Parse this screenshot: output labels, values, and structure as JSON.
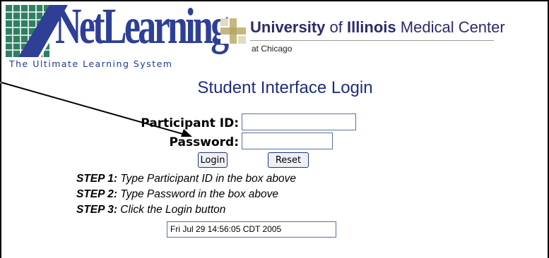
{
  "netlearning": {
    "brand": "NetLearning",
    "tagline": "The Ultimate Learning System"
  },
  "uic": {
    "title_bold": "University",
    "title_of": " of ",
    "title_bold2": "Illinois",
    "title_rest": " Medical Center",
    "subtitle": "at Chicago"
  },
  "heading": "Student Interface Login",
  "form": {
    "participant_label": "Participant ID:",
    "participant_value": "",
    "password_label": "Password:",
    "password_value": "",
    "login_label": "Login",
    "reset_label": "Reset"
  },
  "steps": [
    {
      "num": "STEP 1:",
      "text": " Type Participant ID in the box above"
    },
    {
      "num": "STEP 2:",
      "text": " Type Password in the box above"
    },
    {
      "num": "STEP 3:",
      "text": " Click the Login button"
    }
  ],
  "timestamp": "Fri Jul 29 14:56:05 CDT 2005",
  "colors": {
    "brand_blue": "#2e3f95",
    "brand_green": "#2f7f62",
    "uic_navy": "#2d2a6a",
    "uic_gold": "#c5b780"
  }
}
